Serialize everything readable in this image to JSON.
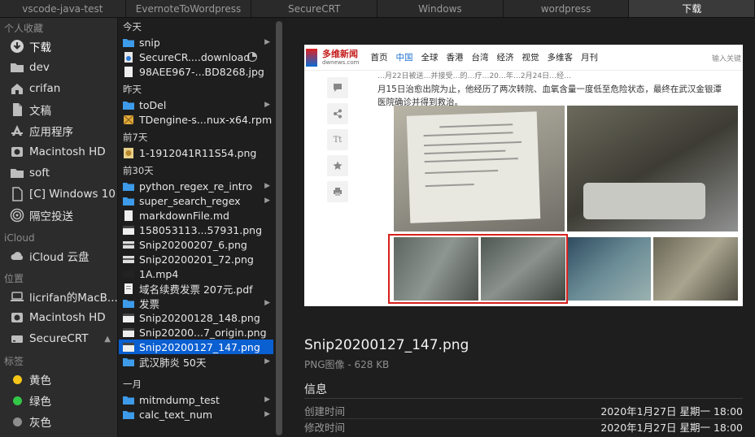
{
  "tabs": [
    {
      "label": "vscode-java-test"
    },
    {
      "label": "EvernoteToWordpress"
    },
    {
      "label": "SecureCRT"
    },
    {
      "label": "Windows"
    },
    {
      "label": "wordpress"
    },
    {
      "label": "下载"
    }
  ],
  "sidebar": {
    "favorites_title": "个人收藏",
    "favorites": [
      {
        "label": "下载",
        "icon": "download-icon"
      },
      {
        "label": "dev",
        "icon": "folder-icon"
      },
      {
        "label": "crifan",
        "icon": "home-icon"
      },
      {
        "label": "文稿",
        "icon": "document-icon"
      },
      {
        "label": "应用程序",
        "icon": "applications-icon"
      },
      {
        "label": "Macintosh HD",
        "icon": "disk-icon"
      },
      {
        "label": "soft",
        "icon": "folder-icon"
      },
      {
        "label": "[C] Windows 10",
        "icon": "document-icon"
      },
      {
        "label": "隔空投送",
        "icon": "airdrop-icon"
      }
    ],
    "icloud_title": "iCloud",
    "icloud": [
      {
        "label": "iCloud 云盘",
        "icon": "cloud-icon"
      }
    ],
    "locations_title": "位置",
    "locations": [
      {
        "label": "licrifan的MacB...",
        "icon": "laptop-icon"
      },
      {
        "label": "Macintosh HD",
        "icon": "disk-icon"
      },
      {
        "label": "SecureCRT",
        "icon": "drive-icon",
        "eject": "▲"
      }
    ],
    "tags_title": "标签",
    "tags": [
      {
        "label": "黄色",
        "color": "#f5c518"
      },
      {
        "label": "绿色",
        "color": "#33c748"
      },
      {
        "label": "灰色",
        "color": "#8e8e8e"
      }
    ]
  },
  "files": {
    "groups": [
      {
        "title": "今天",
        "items": [
          {
            "name": "snip",
            "type": "folder",
            "chevron": "▶"
          },
          {
            "name": "SecureCR....download",
            "type": "download",
            "progress": true
          },
          {
            "name": "98AEE967-...BD8268.jpg",
            "type": "image"
          }
        ]
      },
      {
        "title": "昨天",
        "items": [
          {
            "name": "toDel",
            "type": "folder",
            "chevron": "▶"
          },
          {
            "name": "TDengine-s...nux-x64.rpm",
            "type": "package"
          }
        ]
      },
      {
        "title": "前7天",
        "items": [
          {
            "name": "1-1912041R11S54.png",
            "type": "photo"
          }
        ]
      },
      {
        "title": "前30天",
        "items": [
          {
            "name": "python_regex_re_intro",
            "type": "folder",
            "chevron": "▶"
          },
          {
            "name": "super_search_regex",
            "type": "folder",
            "chevron": "▶"
          },
          {
            "name": "markdownFile.md",
            "type": "text"
          },
          {
            "name": "158053113...57931.png",
            "type": "screenshot"
          },
          {
            "name": "Snip20200207_6.png",
            "type": "screenshot"
          },
          {
            "name": "Snip20200201_72.png",
            "type": "screenshot"
          },
          {
            "name": "1A.mp4",
            "type": "video"
          },
          {
            "name": "域名续费发票 207元.pdf",
            "type": "pdf"
          },
          {
            "name": "发票",
            "type": "folder",
            "chevron": "▶"
          },
          {
            "name": "Snip20200128_148.png",
            "type": "screenshot"
          },
          {
            "name": "Snip20200...7_origin.png",
            "type": "screenshot"
          },
          {
            "name": "Snip20200127_147.png",
            "type": "screenshot",
            "selected": true
          },
          {
            "name": "武汉肺炎 50天",
            "type": "folder",
            "chevron": "▶"
          }
        ]
      },
      {
        "title": "一月",
        "items": [
          {
            "name": "mitmdump_test",
            "type": "folder",
            "chevron": "▶"
          },
          {
            "name": "calc_text_num",
            "type": "folder",
            "chevron": "▶"
          }
        ]
      }
    ]
  },
  "preview": {
    "site": {
      "logo_cn": "多维新闻",
      "logo_en": "dwnews.com",
      "nav": [
        "首页",
        "中国",
        "全球",
        "香港",
        "台湾",
        "经济",
        "视觉",
        "多维客",
        "月刊"
      ],
      "nav_active": "中国",
      "search": "输入关键",
      "text_line1": "…月22日被送…并接受…的…疗…20…年…2月24日…经…",
      "text_line2": "月15日治愈出院为止，他经历了两次转院、血氧含量一度低至危险状态，最终在武汉金银潭",
      "text_line3": "医院确诊并得到救治。",
      "tools": [
        "comment-icon",
        "share-icon",
        "font-size-icon",
        "star-icon",
        "print-icon"
      ],
      "font_tool": "Tt"
    },
    "file_title": "Snip20200127_147.png",
    "file_subtitle": "PNG图像 - 628 KB",
    "info_title": "信息",
    "info": [
      {
        "key": "创建时间",
        "value": "2020年1月27日 星期一 18:00"
      },
      {
        "key": "修改时间",
        "value": "2020年1月27日 星期一 18:00"
      }
    ]
  }
}
